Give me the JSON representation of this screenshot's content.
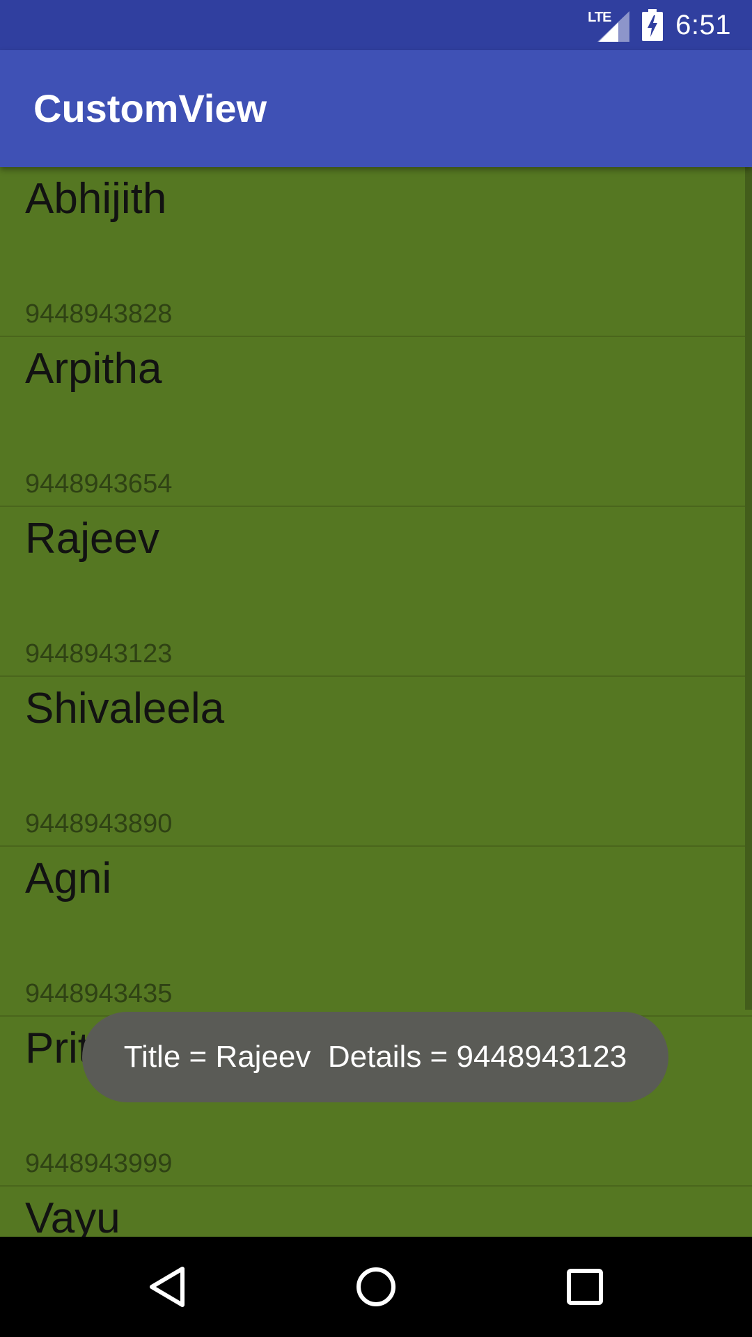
{
  "status_bar": {
    "network_type": "LTE",
    "time": "6:51",
    "signal_icon": "cell-signal-icon",
    "battery_icon": "battery-charging-icon"
  },
  "app_bar": {
    "title": "CustomView"
  },
  "list": {
    "items": [
      {
        "title": "Abhijith",
        "details": "9448943828"
      },
      {
        "title": "Arpitha",
        "details": "9448943654"
      },
      {
        "title": "Rajeev",
        "details": "9448943123"
      },
      {
        "title": "Shivaleela",
        "details": "9448943890"
      },
      {
        "title": "Agni",
        "details": "9448943435"
      },
      {
        "title": "Pritvi",
        "details": "9448943999"
      },
      {
        "title": "Vayu",
        "details": ""
      }
    ]
  },
  "toast": {
    "text": "Title = Rajeev  Details = 9448943123"
  },
  "nav_bar": {
    "back_icon": "back-triangle-icon",
    "home_icon": "home-circle-icon",
    "recents_icon": "recents-square-icon"
  },
  "colors": {
    "status_bar": "#303F9F",
    "app_bar": "#3F51B5",
    "list_background": "#557722",
    "toast_background": "#5A5B56"
  }
}
